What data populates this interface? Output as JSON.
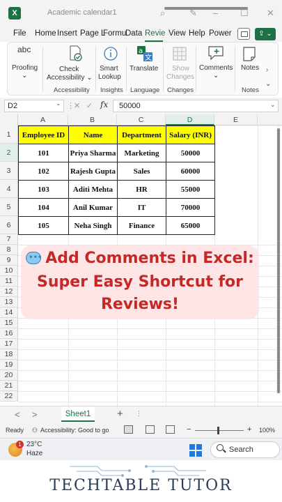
{
  "titlebar": {
    "app_icon_letter": "X",
    "doc_title": "Academic calendar1"
  },
  "ribbon_tabs": [
    "File",
    "Home",
    "Insert",
    "Page L",
    "Formu",
    "Data",
    "Revie",
    "View",
    "Help",
    "Power"
  ],
  "active_tab": "Revie",
  "ribbon": {
    "proofing": {
      "icon_text": "abc",
      "label": "Proofing",
      "caret": "⌄"
    },
    "accessibility": {
      "button_line1": "Check",
      "button_line2": "Accessibility ⌄",
      "group_label": "Accessibility"
    },
    "insights": {
      "button_line1": "Smart",
      "button_line2": "Lookup",
      "group_label": "Insights"
    },
    "language": {
      "button": "Translate",
      "group_label": "Language"
    },
    "changes": {
      "button_line1": "Show",
      "button_line2": "Changes",
      "group_label": "Changes"
    },
    "comments": {
      "button": "Comments",
      "caret": "⌄"
    },
    "notes": {
      "button": "Notes",
      "group_label": "Notes",
      "more": "›"
    },
    "collapse": "⌄"
  },
  "formula_bar": {
    "name_box": "D2",
    "fx": "fx",
    "value": "50000",
    "sep_x": "✕",
    "sep_check": "✓",
    "dots": "⋮"
  },
  "columns": [
    "A",
    "B",
    "C",
    "D",
    "E"
  ],
  "rows": [
    "1",
    "2",
    "3",
    "4",
    "5",
    "6",
    "7",
    "8",
    "9",
    "10",
    "11",
    "12",
    "13",
    "14",
    "15",
    "16",
    "17",
    "18",
    "19",
    "20",
    "21",
    "22"
  ],
  "table": {
    "headers": [
      "Employee ID",
      "Name",
      "Department",
      "Salary (INR)"
    ],
    "rows": [
      [
        "101",
        "Priya Sharma",
        "Marketing",
        "50000"
      ],
      [
        "102",
        "Rajesh Gupta",
        "Sales",
        "60000"
      ],
      [
        "103",
        "Aditi Mehta",
        "HR",
        "55000"
      ],
      [
        "104",
        "Anil Kumar",
        "IT",
        "70000"
      ],
      [
        "105",
        "Neha Singh",
        "Finance",
        "65000"
      ]
    ]
  },
  "overlay": {
    "line1": "Add Comments in Excel:",
    "line2": "Super Easy Shortcut for",
    "line3": "Reviews!"
  },
  "sheets": {
    "active": "Sheet1",
    "add": "+",
    "prev": "<",
    "next": ">",
    "dots": "⋮"
  },
  "status": {
    "ready": "Ready",
    "accessibility": "Accessibility: Good to go",
    "zoom_minus": "−",
    "zoom_plus": "+",
    "zoom": "100%"
  },
  "taskbar": {
    "temperature": "23°C",
    "weather": "Haze",
    "badge": "1",
    "search": "Search"
  },
  "brand": "TECHTABLE TUTOR",
  "colors": {
    "excel_green": "#1e7145",
    "header_yellow": "#ffff00",
    "overlay_text": "#c62828",
    "brand_text": "#2b3d54"
  }
}
